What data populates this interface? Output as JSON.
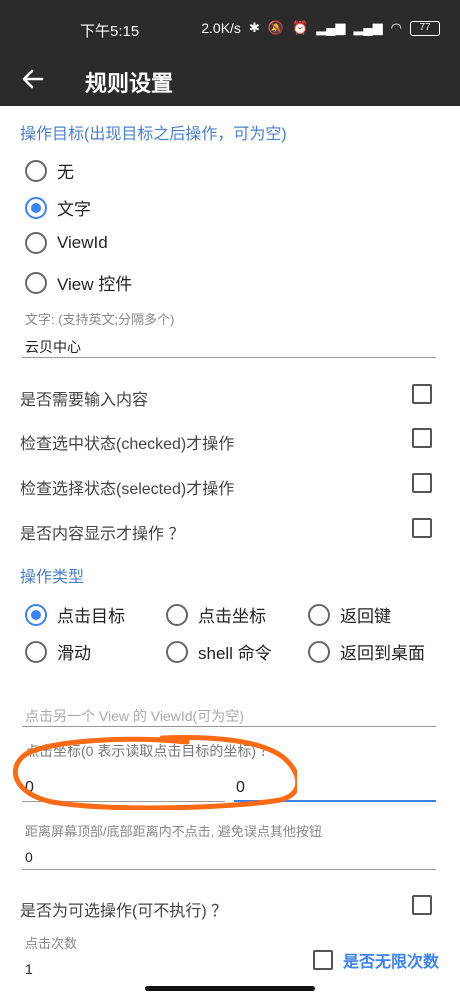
{
  "status": {
    "time": "下午5:15",
    "speed": "2.0K/s",
    "battery": "77"
  },
  "appbar": {
    "title": "规则设置"
  },
  "target_section": {
    "title": "操作目标(出现目标之后操作，可为空)",
    "options": [
      "无",
      "文字",
      "ViewId",
      "View 控件"
    ],
    "selected": "文字"
  },
  "text_field": {
    "label": "文字: (支持英文;分隔多个)",
    "value": "云贝中心"
  },
  "checks": [
    {
      "label": "是否需要输入内容",
      "checked": false
    },
    {
      "label": "检查选中状态(checked)才操作",
      "checked": false
    },
    {
      "label": "检查选择状态(selected)才操作",
      "checked": false
    },
    {
      "label": "是否内容显示才操作 ？",
      "checked": false
    }
  ],
  "op_type": {
    "title": "操作类型",
    "row1": [
      "点击目标",
      "点击坐标",
      "返回键"
    ],
    "row2": [
      "滑动",
      "shell 命令",
      "返回到桌面"
    ],
    "selected": "点击目标"
  },
  "viewid_field": {
    "placeholder": "点击另一个 View 的 ViewId(可为空)"
  },
  "coord": {
    "label": "点击坐标(0 表示读取点击目标的坐标) ？",
    "x": "0",
    "y": "0"
  },
  "edge": {
    "label": "距离屏幕顶部/底部距离内不点击, 避免误点其他按钮",
    "value": "0"
  },
  "optional": {
    "label": "是否为可选操作(可不执行) ？",
    "checked": false
  },
  "clicks": {
    "label": "点击次数",
    "value": "1"
  },
  "infinite": {
    "label": "是否无限次数",
    "checked": false
  },
  "colors": {
    "accent": "#3b82f6",
    "section": "#4a7fd0",
    "bar": "#2b2b2b",
    "annotation": "#ff6a13"
  }
}
